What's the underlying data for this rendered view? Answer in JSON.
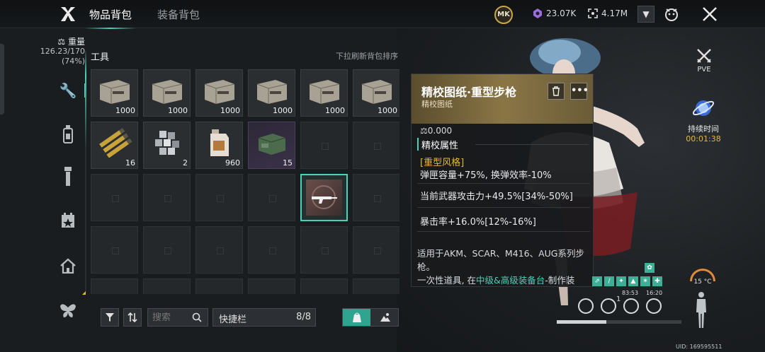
{
  "header": {
    "tabs": [
      {
        "label": "物品背包",
        "active": true
      },
      {
        "label": "装备背包",
        "active": false
      }
    ],
    "badge_text": "MK",
    "resources": [
      {
        "icon": "crystal-icon",
        "value": "23.07K"
      },
      {
        "icon": "frame-icon",
        "value": "4.17M"
      }
    ]
  },
  "weight": {
    "title": "重量",
    "value": "126.23/170",
    "percent": "(74%)"
  },
  "categories": [
    {
      "icon": "wrench-icon",
      "active": true
    },
    {
      "icon": "bottle-icon",
      "active": false
    },
    {
      "icon": "flashlight-icon",
      "active": false
    },
    {
      "icon": "calendar-star-icon",
      "active": false
    },
    {
      "icon": "house-icon",
      "active": false
    },
    {
      "icon": "butterfly-icon",
      "active": false
    }
  ],
  "section": {
    "title": "工具",
    "hint": "下拉刷新背包排序"
  },
  "slots_row1": [
    {
      "qty": "1000"
    },
    {
      "qty": "1000"
    },
    {
      "qty": "1000"
    },
    {
      "qty": "1000"
    },
    {
      "qty": "1000"
    },
    {
      "qty": "1000"
    }
  ],
  "slots_row2": [
    {
      "qty": "16"
    },
    {
      "qty": "2"
    },
    {
      "qty": "960"
    },
    {
      "qty": "15"
    }
  ],
  "toolbar": {
    "search_placeholder": "搜索",
    "quickbar_label": "快捷栏",
    "quickbar_count": "8/8"
  },
  "detail": {
    "title": "精校图纸·重型步枪",
    "subtitle": "精校图纸",
    "weight": "0.000",
    "section_title": "精校属性",
    "style_tag": "[重型风格]",
    "attr1": "弹匣容量+75%, 换弹效率-10%",
    "attr2": "当前武器攻击力+49.5%[34%-50%]",
    "attr3": "暴击率+16.0%[12%-16%]",
    "desc1": "适用于AKM、SCAR、M416、AUG系列步枪。",
    "desc2_prefix": "一次性道具, 在",
    "desc2_highlight": "中级&高级装备台",
    "desc2_suffix": "-制作装"
  },
  "side": {
    "mode_label": "PVE",
    "duration_label": "持续时间",
    "duration_value": "00:01:38",
    "temperature": "15 °C",
    "status_times": [
      "83:53",
      "16:20"
    ],
    "status_num": "1",
    "hp_fraction": 0.4,
    "uid": "UID: 169595511"
  },
  "colors": {
    "accent": "#4fd1b8",
    "gold": "#e3b93a",
    "bg": "#1a1d20"
  }
}
